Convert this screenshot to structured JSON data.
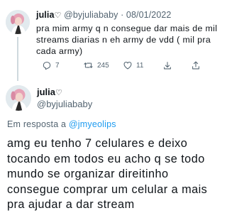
{
  "parent_tweet": {
    "display_name": "julia",
    "name_symbol": "♡",
    "handle": "@byjuliababy",
    "separator": "·",
    "date": "08/01/2022",
    "text_lines": [
      "pra mim army q n consegue dar mais de mil",
      "streams diarias n eh army de vdd ( mil pra",
      "cada army)"
    ],
    "actions": {
      "reply_icon": "reply-icon",
      "reply_count": "7",
      "retweet_icon": "retweet-icon",
      "retweet_count": "245",
      "like_icon": "heart-icon",
      "like_count": "11",
      "share_icon": "share-icon",
      "upload_icon": "upload-icon"
    }
  },
  "reply_tweet": {
    "display_name": "julia",
    "name_symbol": "♡",
    "handle": "@byjuliababy",
    "replying_prefix": "Em resposta a",
    "replying_to": "@jmyeolips",
    "text_lines": [
      "amg eu tenho 7 celulares e deixo",
      "tocando em todos eu acho q se todo",
      "mundo se organizar direitinho",
      "consegue comprar um celular a mais",
      "pra ajudar a dar stream"
    ]
  },
  "colors": {
    "text": "#0f1419",
    "secondary": "#536471",
    "link": "#1d9bf0",
    "thread_line": "#cfd9de"
  }
}
